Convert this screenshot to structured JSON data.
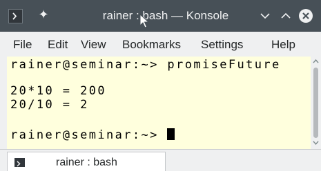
{
  "window": {
    "title": "rainer : bash — Konsole",
    "pin_glyph": "✦",
    "icons": {
      "app": "terminal-app-icon",
      "pin": "pin-icon",
      "minimize": "chevron-down-icon",
      "maximize": "chevron-up-icon",
      "close": "close-icon"
    }
  },
  "menubar": {
    "items": [
      "File",
      "Edit",
      "View",
      "Bookmarks",
      "Settings",
      "Help"
    ]
  },
  "terminal": {
    "lines": [
      "rainer@seminar:~> promiseFuture",
      "",
      "20*10 = 200",
      "20/10 = 2",
      "",
      "rainer@seminar:~> "
    ],
    "background": "#ffffdd",
    "foreground": "#000000"
  },
  "tabs": [
    {
      "label": "rainer : bash",
      "active": true
    }
  ],
  "colors": {
    "titlebar": "#475057",
    "titlebar_text": "#eff0f1",
    "chrome": "#eff0f1",
    "close_button": "#eff0f1"
  }
}
